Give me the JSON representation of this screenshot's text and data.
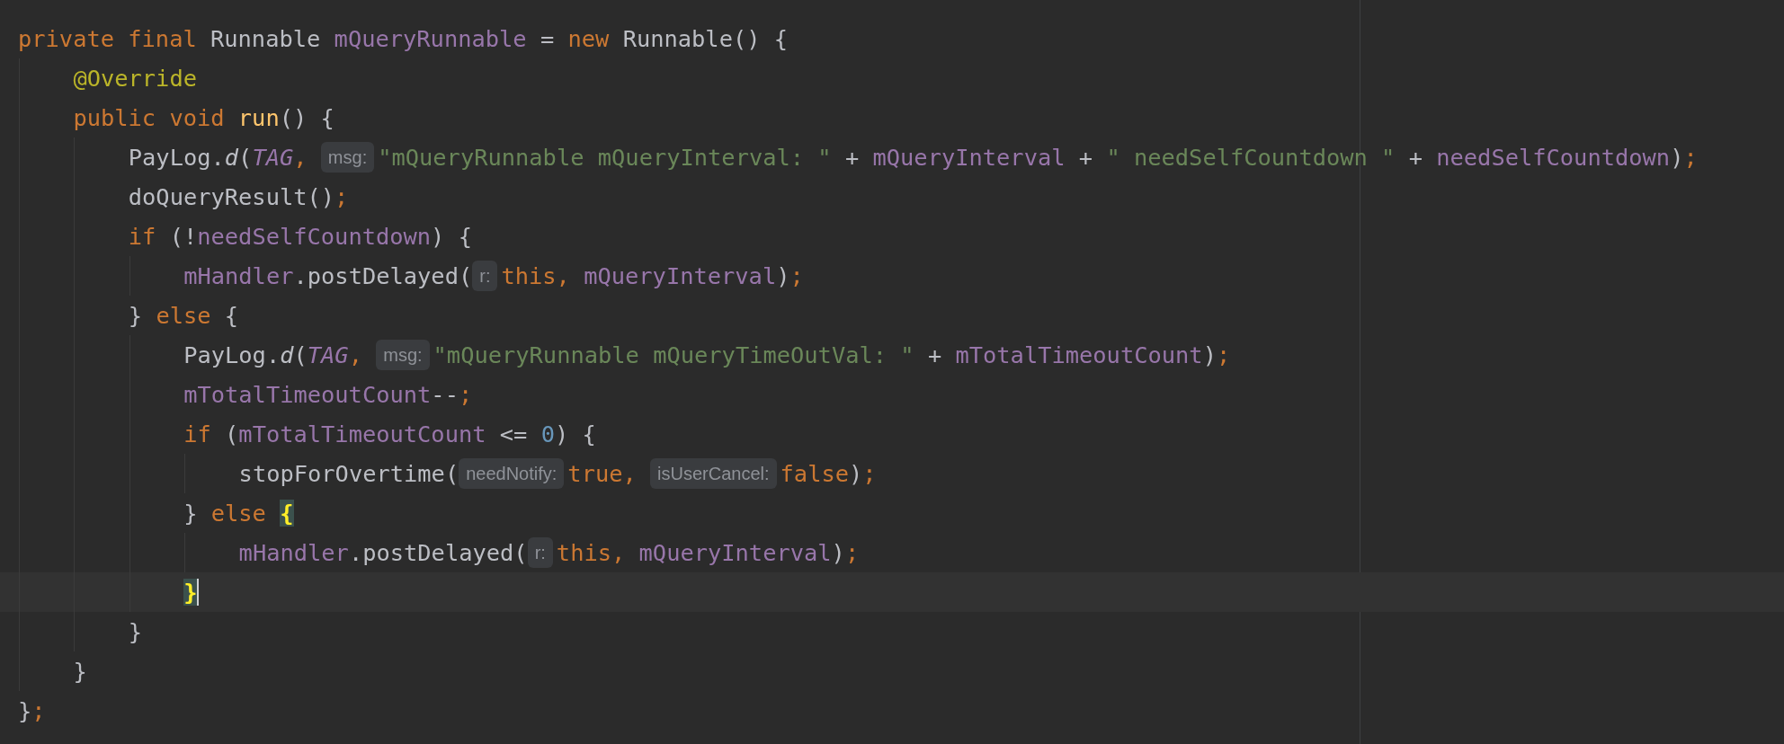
{
  "editor": {
    "lines": [
      {
        "current": false,
        "tokens": [
          {
            "kind": "keyword",
            "text": "private final "
          },
          {
            "kind": "plain",
            "text": "Runnable "
          },
          {
            "kind": "field",
            "text": "mQueryRunnable"
          },
          {
            "kind": "plain",
            "text": " = "
          },
          {
            "kind": "keyword",
            "text": "new "
          },
          {
            "kind": "plain",
            "text": "Runnable() {"
          }
        ],
        "children": [
          {
            "current": false,
            "tokens": [
              {
                "kind": "annotation",
                "text": "@Override"
              }
            ]
          },
          {
            "current": false,
            "tokens": [
              {
                "kind": "keyword",
                "text": "public void "
              },
              {
                "kind": "method",
                "text": "run"
              },
              {
                "kind": "plain",
                "text": "() {"
              }
            ],
            "children": [
              {
                "current": false,
                "tokens": [
                  {
                    "kind": "plain",
                    "text": "PayLog."
                  },
                  {
                    "kind": "italic",
                    "text": "d"
                  },
                  {
                    "kind": "plain",
                    "text": "("
                  },
                  {
                    "kind": "static",
                    "text": "TAG"
                  },
                  {
                    "kind": "punct",
                    "text": ", "
                  },
                  {
                    "kind": "hint",
                    "text": "msg:"
                  },
                  {
                    "kind": "string",
                    "text": "\"mQueryRunnable mQueryInterval: \""
                  },
                  {
                    "kind": "plain",
                    "text": " + "
                  },
                  {
                    "kind": "field",
                    "text": "mQueryInterval"
                  },
                  {
                    "kind": "plain",
                    "text": " + "
                  },
                  {
                    "kind": "string",
                    "text": "\" needSelfCountdown \""
                  },
                  {
                    "kind": "plain",
                    "text": " + "
                  },
                  {
                    "kind": "field",
                    "text": "needSelfCountdown"
                  },
                  {
                    "kind": "plain",
                    "text": ")"
                  },
                  {
                    "kind": "punct",
                    "text": ";"
                  }
                ]
              },
              {
                "current": false,
                "tokens": [
                  {
                    "kind": "plain",
                    "text": "doQueryResult()"
                  },
                  {
                    "kind": "punct",
                    "text": ";"
                  }
                ]
              },
              {
                "current": false,
                "tokens": [
                  {
                    "kind": "keyword",
                    "text": "if "
                  },
                  {
                    "kind": "plain",
                    "text": "(!"
                  },
                  {
                    "kind": "field",
                    "text": "needSelfCountdown"
                  },
                  {
                    "kind": "plain",
                    "text": ") {"
                  }
                ],
                "children": [
                  {
                    "current": false,
                    "tokens": [
                      {
                        "kind": "field",
                        "text": "mHandler"
                      },
                      {
                        "kind": "plain",
                        "text": ".postDelayed("
                      },
                      {
                        "kind": "hint",
                        "text": "r:"
                      },
                      {
                        "kind": "keyword",
                        "text": "this"
                      },
                      {
                        "kind": "punct",
                        "text": ", "
                      },
                      {
                        "kind": "field",
                        "text": "mQueryInterval"
                      },
                      {
                        "kind": "plain",
                        "text": ")"
                      },
                      {
                        "kind": "punct",
                        "text": ";"
                      }
                    ]
                  }
                ]
              },
              {
                "current": false,
                "tokens": [
                  {
                    "kind": "plain",
                    "text": "} "
                  },
                  {
                    "kind": "keyword",
                    "text": "else "
                  },
                  {
                    "kind": "plain",
                    "text": "{"
                  }
                ],
                "children": [
                  {
                    "current": false,
                    "tokens": [
                      {
                        "kind": "plain",
                        "text": "PayLog."
                      },
                      {
                        "kind": "italic",
                        "text": "d"
                      },
                      {
                        "kind": "plain",
                        "text": "("
                      },
                      {
                        "kind": "static",
                        "text": "TAG"
                      },
                      {
                        "kind": "punct",
                        "text": ", "
                      },
                      {
                        "kind": "hint",
                        "text": "msg:"
                      },
                      {
                        "kind": "string",
                        "text": "\"mQueryRunnable mQueryTimeOutVal: \""
                      },
                      {
                        "kind": "plain",
                        "text": " + "
                      },
                      {
                        "kind": "field",
                        "text": "mTotalTimeoutCount"
                      },
                      {
                        "kind": "plain",
                        "text": ")"
                      },
                      {
                        "kind": "punct",
                        "text": ";"
                      }
                    ]
                  },
                  {
                    "current": false,
                    "tokens": [
                      {
                        "kind": "field",
                        "text": "mTotalTimeoutCount"
                      },
                      {
                        "kind": "plain",
                        "text": "--"
                      },
                      {
                        "kind": "punct",
                        "text": ";"
                      }
                    ]
                  },
                  {
                    "current": false,
                    "tokens": [
                      {
                        "kind": "keyword",
                        "text": "if "
                      },
                      {
                        "kind": "plain",
                        "text": "("
                      },
                      {
                        "kind": "field",
                        "text": "mTotalTimeoutCount"
                      },
                      {
                        "kind": "plain",
                        "text": " <= "
                      },
                      {
                        "kind": "number",
                        "text": "0"
                      },
                      {
                        "kind": "plain",
                        "text": ") {"
                      }
                    ],
                    "children": [
                      {
                        "current": false,
                        "tokens": [
                          {
                            "kind": "plain",
                            "text": "stopForOvertime("
                          },
                          {
                            "kind": "hint",
                            "text": "needNotify:"
                          },
                          {
                            "kind": "keyword",
                            "text": "true"
                          },
                          {
                            "kind": "punct",
                            "text": ", "
                          },
                          {
                            "kind": "hint",
                            "text": "isUserCancel:"
                          },
                          {
                            "kind": "keyword",
                            "text": "false"
                          },
                          {
                            "kind": "plain",
                            "text": ")"
                          },
                          {
                            "kind": "punct",
                            "text": ";"
                          }
                        ]
                      }
                    ]
                  },
                  {
                    "current": false,
                    "tokens": [
                      {
                        "kind": "plain",
                        "text": "} "
                      },
                      {
                        "kind": "keyword",
                        "text": "else "
                      },
                      {
                        "kind": "brace_match",
                        "text": "{"
                      }
                    ],
                    "children": [
                      {
                        "current": false,
                        "tokens": [
                          {
                            "kind": "field",
                            "text": "mHandler"
                          },
                          {
                            "kind": "plain",
                            "text": ".postDelayed("
                          },
                          {
                            "kind": "hint",
                            "text": "r:"
                          },
                          {
                            "kind": "keyword",
                            "text": "this"
                          },
                          {
                            "kind": "punct",
                            "text": ", "
                          },
                          {
                            "kind": "field",
                            "text": "mQueryInterval"
                          },
                          {
                            "kind": "plain",
                            "text": ")"
                          },
                          {
                            "kind": "punct",
                            "text": ";"
                          }
                        ]
                      }
                    ]
                  },
                  {
                    "current": true,
                    "tokens": [
                      {
                        "kind": "brace_match",
                        "text": "}"
                      }
                    ]
                  }
                ]
              },
              {
                "current": false,
                "tokens": [
                  {
                    "kind": "plain",
                    "text": "}"
                  }
                ]
              }
            ]
          },
          {
            "current": false,
            "tokens": [
              {
                "kind": "plain",
                "text": "}"
              }
            ]
          }
        ]
      },
      {
        "current": false,
        "tokens": [
          {
            "kind": "plain",
            "text": "}"
          },
          {
            "kind": "punct",
            "text": ";"
          }
        ]
      }
    ]
  }
}
